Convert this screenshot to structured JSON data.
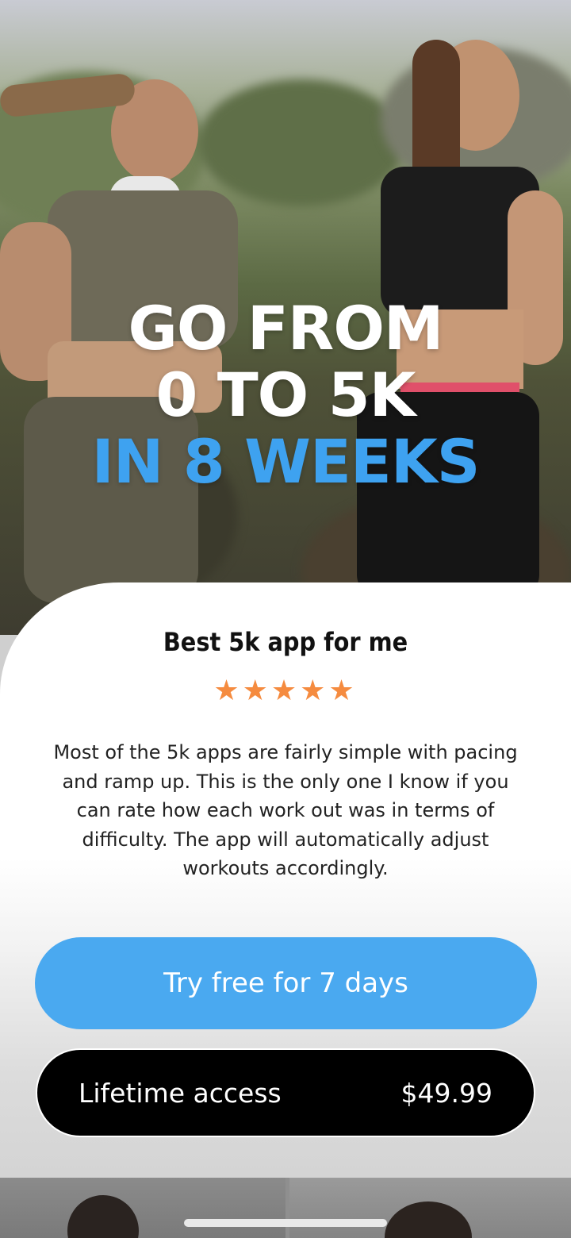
{
  "hero": {
    "headline_line1": "GO FROM",
    "headline_line2": "0 TO 5K",
    "headline_line3": "IN 8 WEEKS",
    "headline_accent_color": "#3ea2f0"
  },
  "review": {
    "title": "Best 5k app for me",
    "rating": 5,
    "stars_text": "★★★★★",
    "star_color": "#f58b3f",
    "body": "Most of the 5k apps are fairly simple with pacing and ramp up. This is the only one I know if you can rate how each work out was in terms of difficulty. The app will automatically adjust workouts accordingly."
  },
  "actions": {
    "trial_label": "Try free for 7 days",
    "trial_color": "#4aa9f0",
    "lifetime_label": "Lifetime access",
    "lifetime_price": "$49.99"
  }
}
